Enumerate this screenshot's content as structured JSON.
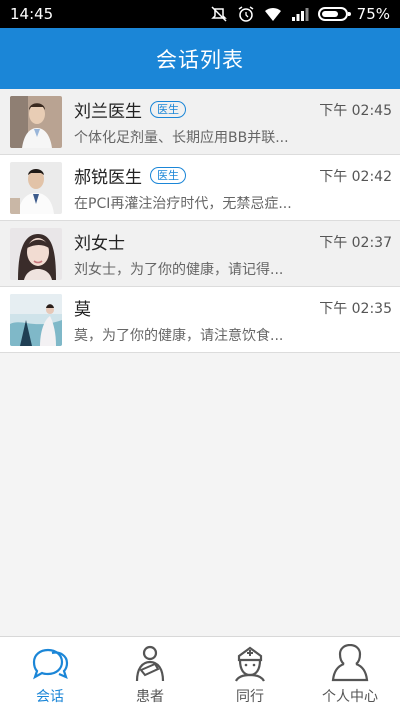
{
  "status": {
    "time": "14:45",
    "battery": "75%",
    "battery_level": 0.75
  },
  "header": {
    "title": "会话列表"
  },
  "conversations": [
    {
      "name": "刘兰医生",
      "badge": "医生",
      "time": "下午 02:45",
      "preview": "个体化足剂量、长期应用BB并联..."
    },
    {
      "name": "郝锐医生",
      "badge": "医生",
      "time": "下午 02:42",
      "preview": "在PCI再灌注治疗时代，无禁忌症..."
    },
    {
      "name": "刘女士",
      "badge": "",
      "time": "下午 02:37",
      "preview": "刘女士，为了你的健康，请记得..."
    },
    {
      "name": "莫",
      "badge": "",
      "time": "下午 02:35",
      "preview": "莫，为了你的健康，请注意饮食..."
    }
  ],
  "tabs": [
    {
      "label": "会话",
      "icon": "chat-bubbles-icon",
      "active": true
    },
    {
      "label": "患者",
      "icon": "patient-icon",
      "active": false
    },
    {
      "label": "同行",
      "icon": "nurse-icon",
      "active": false
    },
    {
      "label": "个人中心",
      "icon": "person-icon",
      "active": false
    }
  ],
  "colors": {
    "accent": "#1b86d7",
    "statusbar": "#000000"
  }
}
